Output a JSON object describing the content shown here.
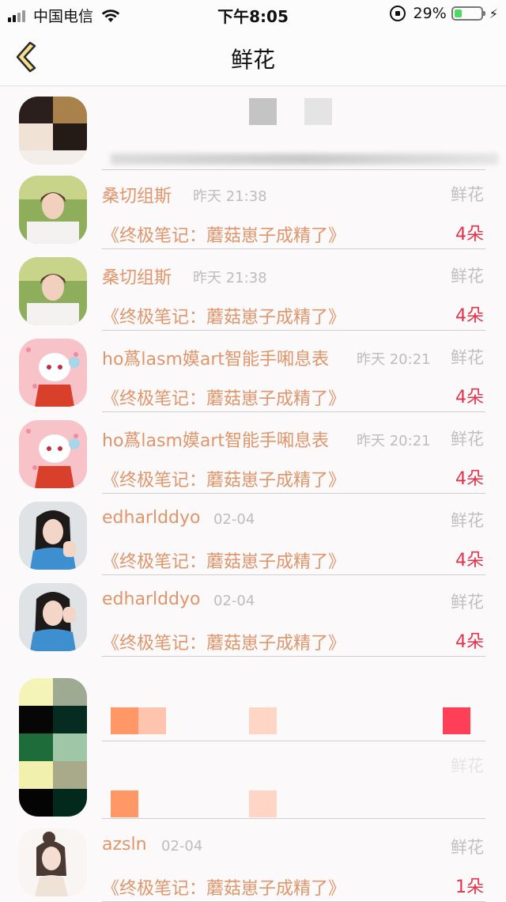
{
  "status_bar": {
    "carrier": "中国电信",
    "time": "下午8:05",
    "battery_percent": "29%",
    "battery_level": 0.29,
    "colors": {
      "battery_fill": "#4cd964"
    }
  },
  "nav": {
    "title": "鲜花",
    "back_icon": "chevron-left-icon"
  },
  "colors": {
    "accent_text": "#e0956a",
    "count_red": "#e2334a",
    "muted": "#bdbdbd",
    "back_chevron_fill": "#f4e08a",
    "back_chevron_stroke": "#2a2a2a"
  },
  "rows": [
    {
      "name": "桑切组斯",
      "time": "昨天 21:38",
      "label": "鲜花",
      "book": "《终极笔记：蘑菇崽子成精了》",
      "count": "4朵"
    },
    {
      "name": "桑切组斯",
      "time": "昨天 21:38",
      "label": "鲜花",
      "book": "《终极笔记：蘑菇崽子成精了》",
      "count": "4朵"
    },
    {
      "name": "ho蔿lasm嫫art智能手啝息表",
      "time": "昨天 20:21",
      "label": "鲜花",
      "book": "《终极笔记：蘑菇崽子成精了》",
      "count": "4朵"
    },
    {
      "name": "ho蔿lasm嫫art智能手啝息表",
      "time": "昨天 20:21",
      "label": "鲜花",
      "book": "《终极笔记：蘑菇崽子成精了》",
      "count": "4朵"
    },
    {
      "name": "edharlddyo",
      "time": "02-04",
      "label": "鲜花",
      "book": "《终极笔记：蘑菇崽子成精了》",
      "count": "4朵"
    },
    {
      "name": "edharlddyo",
      "time": "02-04",
      "label": "鲜花",
      "book": "《终极笔记：蘑菇崽子成精了》",
      "count": "4朵"
    },
    {
      "name": "azsln",
      "time": "02-04",
      "label": "鲜花",
      "book": "《终极笔记：蘑菇崽子成精了》",
      "count": "1朵"
    }
  ],
  "obscured_row_labels": {
    "label": "鲜花"
  }
}
